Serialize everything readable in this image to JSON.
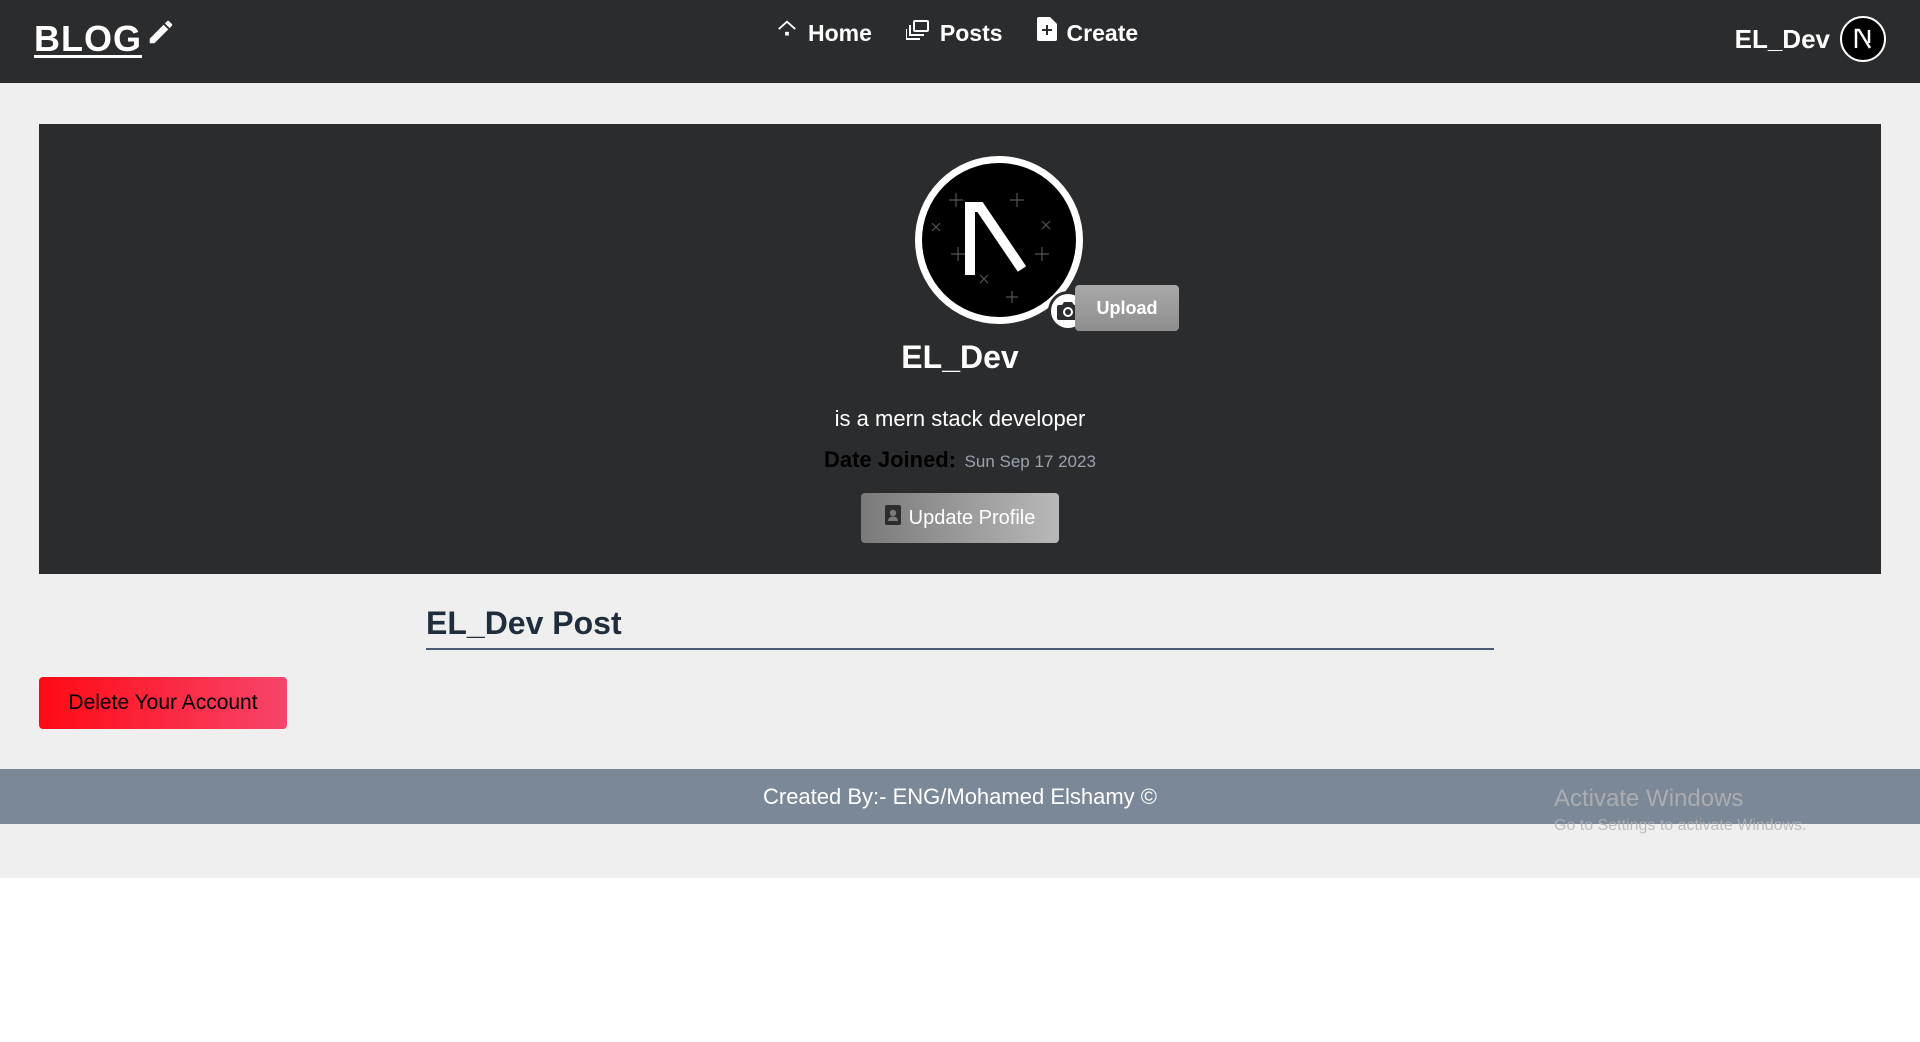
{
  "navbar": {
    "brand": "BLOG",
    "brand_icon": "pencil-icon",
    "links": [
      {
        "label": "Home",
        "icon": "home-icon"
      },
      {
        "label": "Posts",
        "icon": "posts-icon"
      },
      {
        "label": "Create",
        "icon": "file-plus-icon"
      }
    ],
    "username": "EL_Dev",
    "avatar_letter": "N"
  },
  "profile": {
    "avatar_letter": "N",
    "upload_label": "Upload",
    "name": "EL_Dev",
    "bio": "is a mern stack developer",
    "date_joined_label": "Date Joined:",
    "date_joined_value": "Sun Sep 17 2023",
    "update_label": "Update Profile"
  },
  "posts": {
    "heading": "EL_Dev Post"
  },
  "actions": {
    "delete_label": "Delete Your Account"
  },
  "footer": {
    "text": "Created By:- ENG/Mohamed Elshamy ©"
  },
  "watermark": {
    "title": "Activate Windows",
    "subtitle": "Go to Settings to activate Windows."
  },
  "colors": {
    "navbar_bg": "#2b2c2e",
    "page_bg": "#efefef",
    "footer_bg": "#7a8898",
    "delete_gradient_start": "#ff0a14",
    "delete_gradient_end": "#f7456b"
  }
}
